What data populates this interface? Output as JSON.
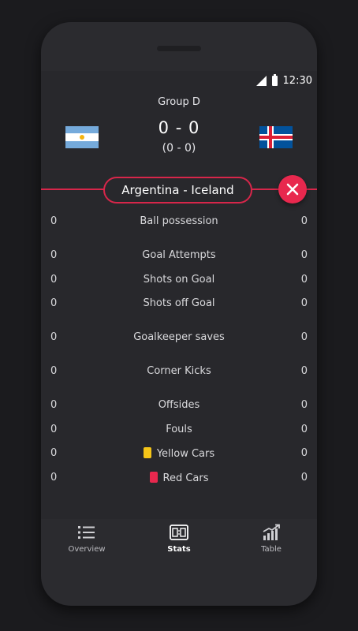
{
  "status": {
    "time": "12:30",
    "icons": [
      "signal-icon",
      "battery-icon"
    ]
  },
  "match": {
    "group": "Group D",
    "score": "0 - 0",
    "half_time": "(0 - 0)",
    "title": "Argentina - Iceland",
    "home_flag": "argentina-flag",
    "away_flag": "iceland-flag"
  },
  "stats": [
    {
      "label": "Ball possession",
      "home": "0",
      "away": "0"
    },
    {
      "label": "Goal Attempts",
      "home": "0",
      "away": "0"
    },
    {
      "label": "Shots on Goal",
      "home": "0",
      "away": "0"
    },
    {
      "label": "Shots off Goal",
      "home": "0",
      "away": "0"
    },
    {
      "label": "Goalkeeper saves",
      "home": "0",
      "away": "0"
    },
    {
      "label": "Corner Kicks",
      "home": "0",
      "away": "0"
    },
    {
      "label": "Offsides",
      "home": "0",
      "away": "0"
    },
    {
      "label": "Fouls",
      "home": "0",
      "away": "0"
    },
    {
      "label": "Yellow Cars",
      "home": "0",
      "away": "0",
      "icon": "yellow-card-icon"
    },
    {
      "label": "Red Cars",
      "home": "0",
      "away": "0",
      "icon": "red-card-icon"
    }
  ],
  "nav": [
    {
      "label": "Overview",
      "icon": "list-icon"
    },
    {
      "label": "Stats",
      "icon": "scoreboard-icon",
      "active": true
    },
    {
      "label": "Table",
      "icon": "trend-chart-icon"
    }
  ],
  "colors": {
    "accent": "#e8284e",
    "background": "#28282c",
    "yellow_card": "#f5c518"
  }
}
